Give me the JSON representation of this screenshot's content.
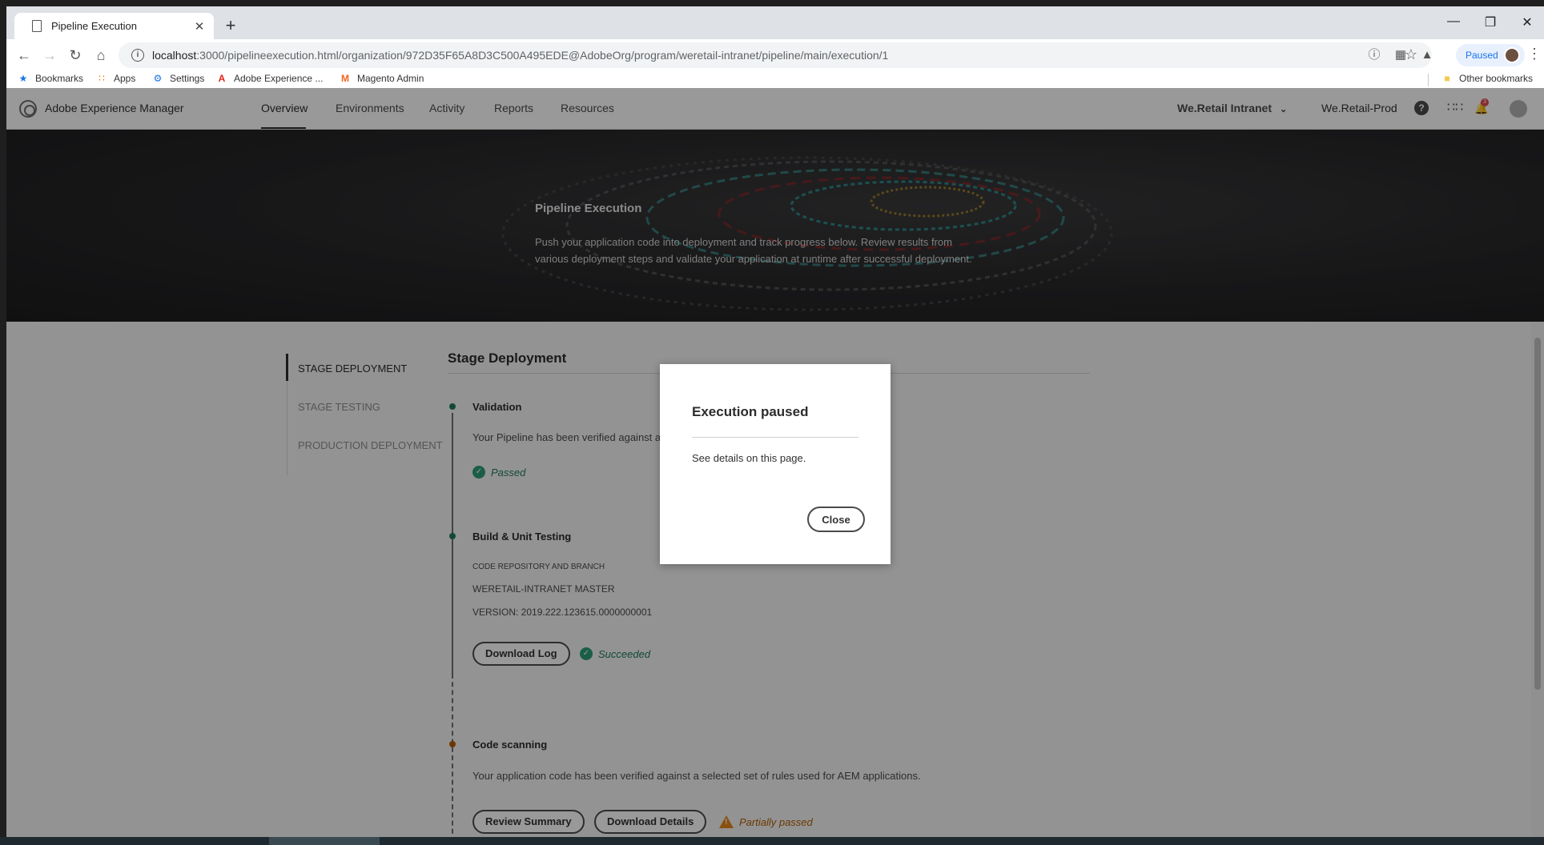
{
  "browser": {
    "tab_title": "Pipeline Execution",
    "tab_close": "✕",
    "new_tab": "+",
    "url_host": "localhost",
    "url_path": ":3000/pipelineexecution.html/organization/972D35F65A8D3C500A495EDE@AdobeOrg/program/weretail-intranet/pipeline/main/execution/1",
    "profile_status": "Paused",
    "bookmarks": [
      {
        "label": "Bookmarks",
        "icon": "star-icon"
      },
      {
        "label": "Apps",
        "icon": "apps-grid-icon"
      },
      {
        "label": "Settings",
        "icon": "gear-icon"
      },
      {
        "label": "Adobe Experience ...",
        "icon": "adobe-icon"
      },
      {
        "label": "Magento Admin",
        "icon": "magento-icon"
      }
    ],
    "other_bookmarks": "Other bookmarks"
  },
  "aem": {
    "app_title": "Adobe Experience Manager",
    "nav": [
      "Overview",
      "Environments",
      "Activity",
      "Reports",
      "Resources"
    ],
    "active_nav": "Overview",
    "org": "We.Retail Intranet",
    "environment": "We.Retail-Prod",
    "notification_count": "3"
  },
  "hero": {
    "title": "Pipeline Execution",
    "description": "Push your application code into deployment and track progress below. Review results from various deployment steps and validate your application at runtime after successful deployment."
  },
  "sidebar": {
    "items": [
      "STAGE DEPLOYMENT",
      "STAGE TESTING",
      "PRODUCTION DEPLOYMENT"
    ]
  },
  "stage": {
    "title": "Stage Deployment",
    "steps": [
      {
        "title": "Validation",
        "text": "Your Pipeline has been verified against a s",
        "status": "Passed"
      },
      {
        "title": "Build & Unit Testing",
        "repo_label": "CODE REPOSITORY AND BRANCH",
        "repo_value": "WERETAIL-INTRANET MASTER",
        "version": "VERSION: 2019.222.123615.0000000001",
        "button": "Download Log",
        "status": "Succeeded"
      },
      {
        "title": "Code scanning",
        "text": "Your application code has been verified against a selected set of rules used for AEM applications.",
        "buttons": [
          "Review Summary",
          "Download Details"
        ],
        "status": "Partially passed"
      }
    ]
  },
  "dialog": {
    "title": "Execution paused",
    "body": "See details on this page.",
    "close_label": "Close"
  },
  "colors": {
    "success": "#2d9d78",
    "warning": "#e68619",
    "badge": "#e34850"
  }
}
